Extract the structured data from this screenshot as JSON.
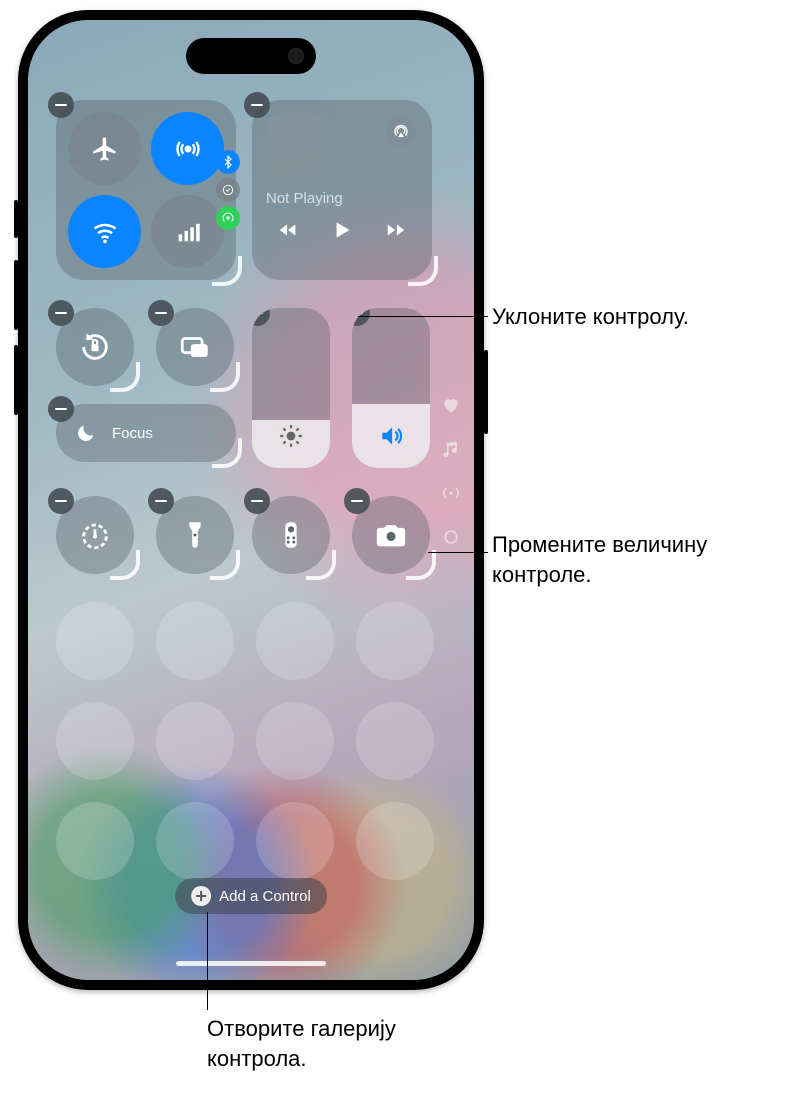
{
  "controls": {
    "connectivity": {
      "airplane": "airplane-icon",
      "airdrop": "airdrop-icon",
      "wifi": "wifi-icon",
      "cellular": "cellular-icon",
      "bluetooth": "bluetooth-icon",
      "hotspot": "hotspot-icon"
    },
    "now_playing": {
      "status": "Not Playing",
      "airplay": "airplay-icon"
    },
    "orientation_lock": "orientation-lock-icon",
    "screen_mirroring": "screen-mirroring-icon",
    "focus": {
      "label": "Focus",
      "icon": "moon-icon"
    },
    "brightness": "brightness-icon",
    "volume": "volume-icon",
    "timer": "timer-icon",
    "flashlight": "flashlight-icon",
    "remote": "apple-tv-remote-icon",
    "camera": "camera-icon"
  },
  "side_indicators": {
    "favorites": "heart-icon",
    "music": "music-note-icon",
    "connectivity": "antenna-icon",
    "home": "circle-icon"
  },
  "add_control_label": "Add a Control",
  "callouts": {
    "remove": "Уклоните контролу.",
    "resize": "Промените величину контроле.",
    "gallery": "Отворите галерију контрола."
  }
}
